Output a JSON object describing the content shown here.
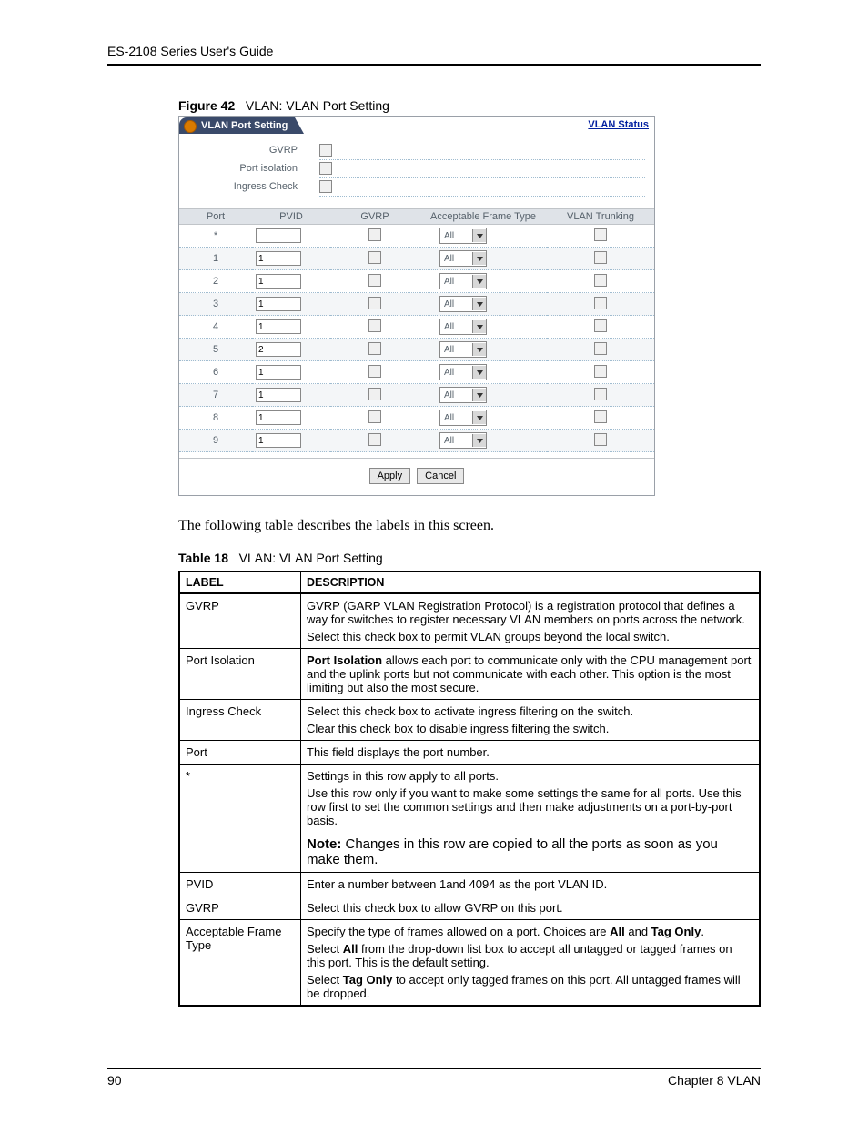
{
  "running_head": "ES-2108 Series User's Guide",
  "figure": {
    "label": "Figure 42",
    "title": "VLAN: VLAN Port Setting"
  },
  "panel": {
    "title": "VLAN Port Setting",
    "status_link": "VLAN Status",
    "top": {
      "gvrp": "GVRP",
      "port_isolation": "Port isolation",
      "ingress_check": "Ingress Check"
    },
    "cols": {
      "port": "Port",
      "pvid": "PVID",
      "gvrp": "GVRP",
      "aft": "Acceptable Frame Type",
      "trunk": "VLAN Trunking"
    },
    "rows": [
      {
        "port": "*",
        "pvid": "",
        "aft": "All"
      },
      {
        "port": "1",
        "pvid": "1",
        "aft": "All"
      },
      {
        "port": "2",
        "pvid": "1",
        "aft": "All"
      },
      {
        "port": "3",
        "pvid": "1",
        "aft": "All"
      },
      {
        "port": "4",
        "pvid": "1",
        "aft": "All"
      },
      {
        "port": "5",
        "pvid": "2",
        "aft": "All"
      },
      {
        "port": "6",
        "pvid": "1",
        "aft": "All"
      },
      {
        "port": "7",
        "pvid": "1",
        "aft": "All"
      },
      {
        "port": "8",
        "pvid": "1",
        "aft": "All"
      },
      {
        "port": "9",
        "pvid": "1",
        "aft": "All"
      }
    ],
    "buttons": {
      "apply": "Apply",
      "cancel": "Cancel"
    }
  },
  "body_text": "The following table describes the labels in this screen.",
  "table_caption": {
    "label": "Table 18",
    "title": "VLAN: VLAN Port Setting"
  },
  "desc_cols": {
    "label": "LABEL",
    "desc": "DESCRIPTION"
  },
  "desc": [
    {
      "label": "GVRP",
      "paras": [
        "GVRP (GARP VLAN Registration Protocol) is a registration protocol that defines a way for switches to register necessary VLAN members on ports across the network.",
        "Select this check box to permit VLAN groups beyond the local switch."
      ]
    },
    {
      "label": "Port Isolation",
      "paras": [
        "<b>Port Isolation</b> allows each port to communicate only with the CPU management port and the uplink ports but not communicate with each other. This option is the most limiting but also the most secure."
      ]
    },
    {
      "label": "Ingress Check",
      "paras": [
        "Select this check box to activate ingress filtering on the switch.",
        "Clear this check box to disable ingress filtering the switch."
      ]
    },
    {
      "label": "Port",
      "paras": [
        "This field displays the port number."
      ]
    },
    {
      "label": "*",
      "paras": [
        "Settings in this row apply to all ports.",
        "Use this row only if you want to make some settings the same for all ports. Use this row first to set the common settings and then make adjustments on a port-by-port basis."
      ],
      "note": "Changes in this row are copied to all the ports as soon as you make them."
    },
    {
      "label": "PVID",
      "paras": [
        "Enter a number between 1and 4094 as the port VLAN ID."
      ]
    },
    {
      "label": "GVRP",
      "paras": [
        "Select this check box to allow GVRP on this port."
      ]
    },
    {
      "label": "Acceptable Frame Type",
      "paras": [
        "Specify the type of frames allowed on a port. Choices are <b>All</b> and <b>Tag Only</b>.",
        "Select <b>All</b> from the drop-down list box to accept all untagged or tagged frames on this port. This is the default setting.",
        "Select <b>Tag Only</b> to accept only tagged frames on this port. All untagged frames will be dropped."
      ]
    }
  ],
  "note_label": "Note:",
  "footer": {
    "page": "90",
    "chapter": "Chapter 8 VLAN"
  }
}
